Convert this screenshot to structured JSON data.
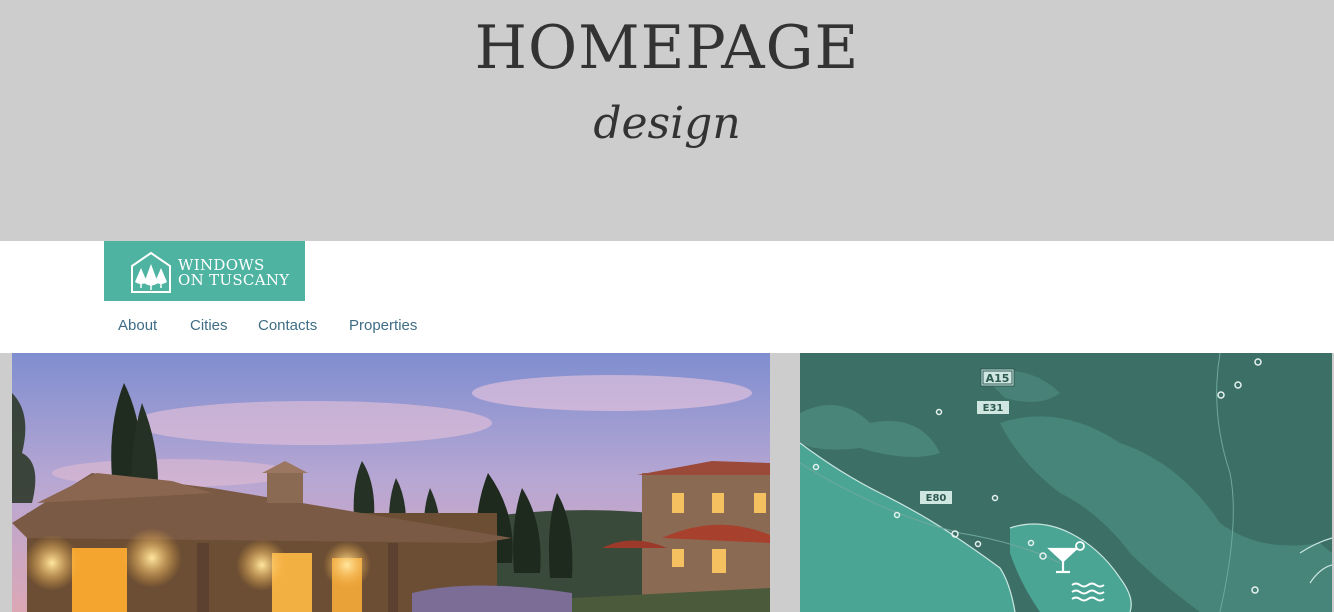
{
  "hero": {
    "title": "HOMEPAGE",
    "subtitle": "design"
  },
  "logo": {
    "line1": "WINDOWS",
    "line2": "ON TUSCANY",
    "brand_color": "#4fb3a2",
    "icon": "house-trees-icon"
  },
  "nav": {
    "items": [
      {
        "label": "About"
      },
      {
        "label": "Cities"
      },
      {
        "label": "Contacts"
      },
      {
        "label": "Properties"
      }
    ],
    "color": "#3f6d86"
  },
  "map": {
    "road_labels": [
      "A15",
      "E31",
      "E80"
    ],
    "icons": [
      "cocktail-icon",
      "waves-icon"
    ]
  },
  "colors": {
    "background_gray": "#cccdcc",
    "map_sea": "#4aa595",
    "map_land": "#3c6f66"
  }
}
